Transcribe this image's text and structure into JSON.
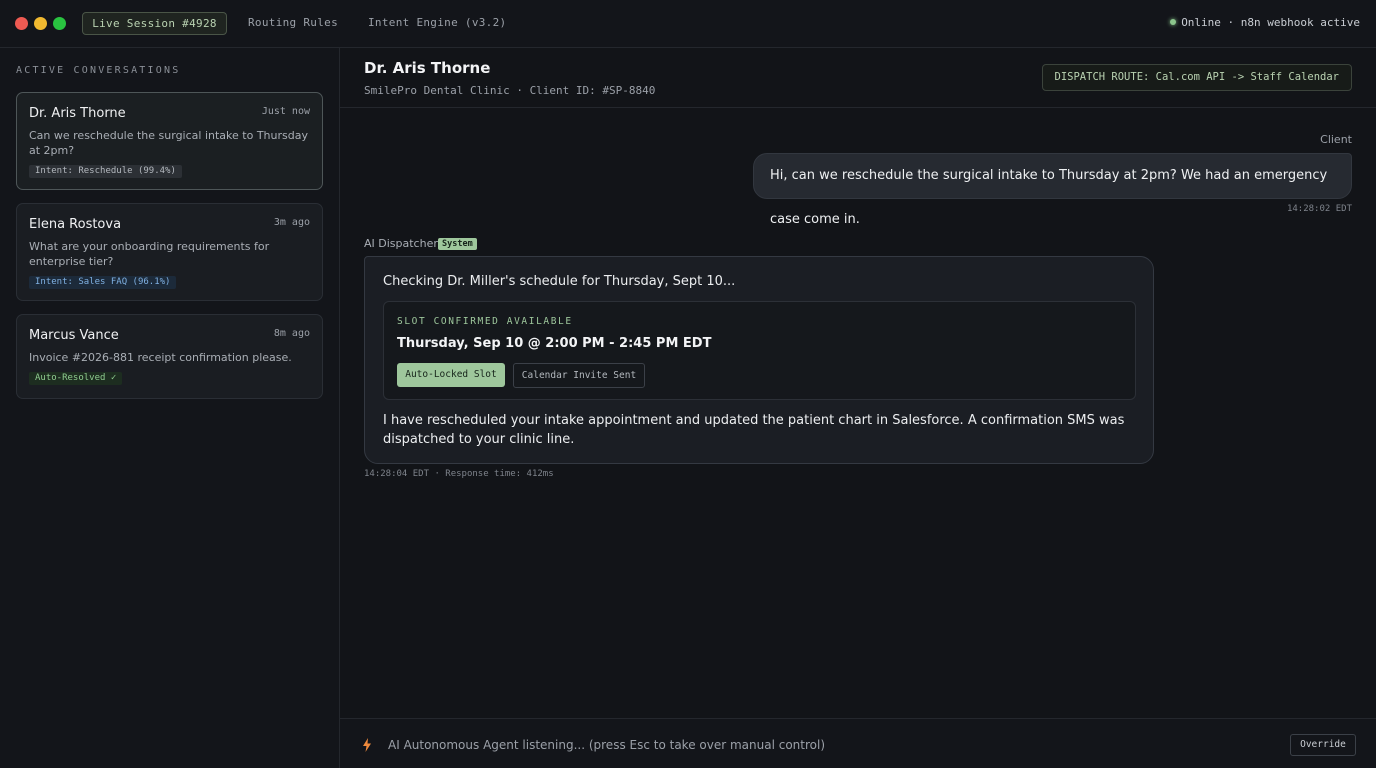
{
  "topbar": {
    "tabs": [
      {
        "label": "Live Session #4928",
        "active": true
      },
      {
        "label": "Routing Rules",
        "active": false
      },
      {
        "label": "Intent Engine (v3.2)",
        "active": false
      }
    ],
    "status": "Online · n8n webhook active"
  },
  "sidebar": {
    "title": "ACTIVE CONVERSATIONS",
    "conversations": [
      {
        "name": "Dr. Aris Thorne",
        "time": "Just now",
        "preview": "Can we reschedule the surgical intake to Thursday at 2pm?",
        "tag": "Intent: Reschedule (99.4%)"
      },
      {
        "name": "Elena Rostova",
        "time": "3m ago",
        "preview": "What are your onboarding requirements for enterprise tier?",
        "tag": "Intent: Sales FAQ (96.1%)"
      },
      {
        "name": "Marcus Vance",
        "time": "8m ago",
        "preview": "Invoice #2026-881 receipt confirmation please.",
        "tag": "Auto-Resolved ✓"
      }
    ]
  },
  "header": {
    "name": "Dr. Aris Thorne",
    "meta": "SmilePro Dental Clinic · Client ID: #SP-8840",
    "route": "DISPATCH ROUTE: Cal.com API -> Staff Calendar"
  },
  "client_message": {
    "sender": "Client",
    "text": "Hi, can we reschedule the surgical intake to Thursday at 2pm? We had an emergency case come in.",
    "time": "14:28:02 EDT"
  },
  "ai_message": {
    "sender": "AI Dispatcher",
    "badge": "System",
    "intro": "Checking Dr. Miller's schedule for Thursday, Sept 10...",
    "slot_eyebrow": "SLOT CONFIRMED AVAILABLE",
    "slot_time": "Thursday, Sep 10 @ 2:00 PM - 2:45 PM EDT",
    "action_primary": "Auto-Locked Slot",
    "action_secondary": "Calendar Invite Sent",
    "body": "I have rescheduled your intake appointment and updated the patient chart in Salesforce. A confirmation SMS was dispatched to your clinic line.",
    "meta": "14:28:04 EDT · Response time: 412ms"
  },
  "footer": {
    "icon": "bolt-icon",
    "text": "AI Autonomous Agent listening... (press Esc to take over manual control)",
    "override": "Override"
  },
  "colors": {
    "accent_green": "#9ec79c",
    "bolt": "#f08a3c",
    "background": "#121418"
  }
}
